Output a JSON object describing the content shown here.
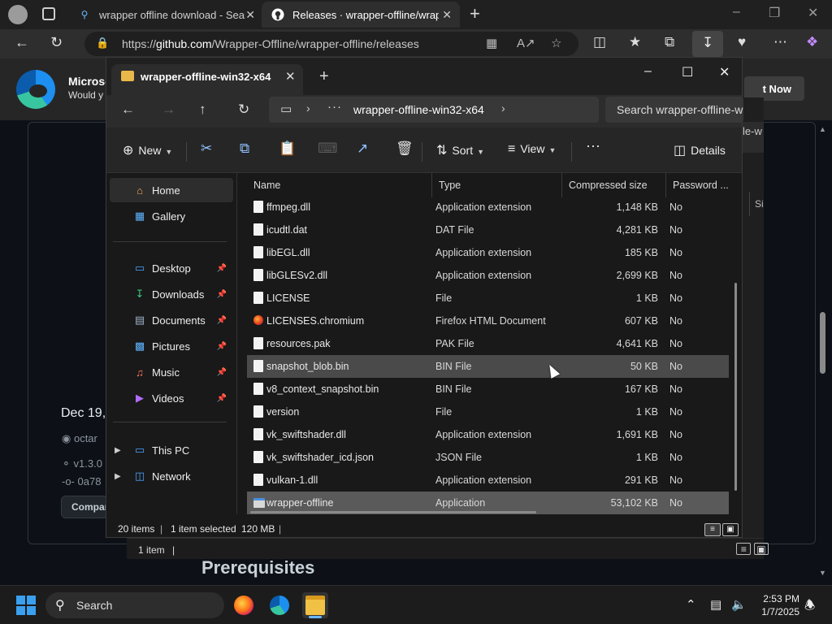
{
  "browser": {
    "tabs": [
      {
        "title": "wrapper offline download - Sear",
        "icon": "search-icon"
      },
      {
        "title": "Releases · wrapper-offline/wrappe",
        "icon": "github-icon"
      }
    ],
    "url_prefix": "https://",
    "url_host": "github.com",
    "url_path": "/Wrapper-Offline/wrapper-offline/releases"
  },
  "banner": {
    "title": "Microso",
    "subtitle": "Would y",
    "button": "t Now"
  },
  "github_page": {
    "release_date": "Dec 19,",
    "author": "octar",
    "tag": "v1.3.0",
    "commit": "0a78",
    "compare_button": "Compar",
    "section_heading": "Prerequisites"
  },
  "back_window": {
    "strip_text": "le-w",
    "column_text": "Si",
    "status_items": "1 item",
    "status_sep": "|"
  },
  "explorer": {
    "tab_title": "wrapper-offline-win32-x64",
    "breadcrumb_folder": "wrapper-offline-win32-x64",
    "search_placeholder": "Search wrapper-offline-w",
    "toolbar": {
      "new": "New",
      "sort": "Sort",
      "view": "View",
      "details": "Details"
    },
    "sidebar": {
      "home": "Home",
      "gallery": "Gallery",
      "desktop": "Desktop",
      "downloads": "Downloads",
      "documents": "Documents",
      "pictures": "Pictures",
      "music": "Music",
      "videos": "Videos",
      "this_pc": "This PC",
      "network": "Network"
    },
    "columns": {
      "name": "Name",
      "type": "Type",
      "size": "Compressed size",
      "password": "Password ..."
    },
    "files": [
      {
        "name": "ffmpeg.dll",
        "type": "Application extension",
        "size": "1,148 KB",
        "password": "No"
      },
      {
        "name": "icudtl.dat",
        "type": "DAT File",
        "size": "4,281 KB",
        "password": "No"
      },
      {
        "name": "libEGL.dll",
        "type": "Application extension",
        "size": "185 KB",
        "password": "No"
      },
      {
        "name": "libGLESv2.dll",
        "type": "Application extension",
        "size": "2,699 KB",
        "password": "No"
      },
      {
        "name": "LICENSE",
        "type": "File",
        "size": "1 KB",
        "password": "No"
      },
      {
        "name": "LICENSES.chromium",
        "type": "Firefox HTML Document",
        "size": "607 KB",
        "password": "No"
      },
      {
        "name": "resources.pak",
        "type": "PAK File",
        "size": "4,641 KB",
        "password": "No"
      },
      {
        "name": "snapshot_blob.bin",
        "type": "BIN File",
        "size": "50 KB",
        "password": "No"
      },
      {
        "name": "v8_context_snapshot.bin",
        "type": "BIN File",
        "size": "167 KB",
        "password": "No"
      },
      {
        "name": "version",
        "type": "File",
        "size": "1 KB",
        "password": "No"
      },
      {
        "name": "vk_swiftshader.dll",
        "type": "Application extension",
        "size": "1,691 KB",
        "password": "No"
      },
      {
        "name": "vk_swiftshader_icd.json",
        "type": "JSON File",
        "size": "1 KB",
        "password": "No"
      },
      {
        "name": "vulkan-1.dll",
        "type": "Application extension",
        "size": "291 KB",
        "password": "No"
      },
      {
        "name": "wrapper-offline",
        "type": "Application",
        "size": "53,102 KB",
        "password": "No"
      }
    ],
    "status": {
      "item_count": "20 items",
      "separator": "|",
      "selection": "1 item selected",
      "selection_size": "120 MB"
    }
  },
  "taskbar": {
    "search_label": "Search",
    "time": "2:53 PM",
    "date": "1/7/2025"
  },
  "colors": {
    "accent": "#4aa3ff",
    "selected_row": "#5a5a5a",
    "folder": "#e8b84a"
  }
}
